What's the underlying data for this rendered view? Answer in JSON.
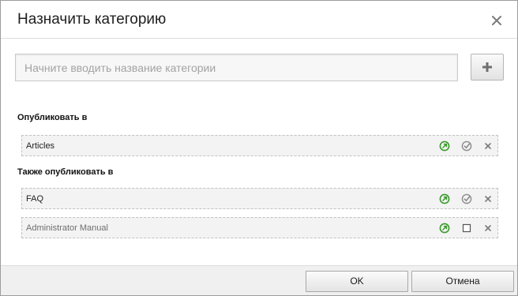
{
  "dialog": {
    "title": "Назначить категорию",
    "close_icon": "close-icon"
  },
  "search": {
    "placeholder": "Начните вводить название категории",
    "value": ""
  },
  "add_button": {
    "icon": "plus-icon"
  },
  "primary": {
    "label": "Опубликовать в",
    "items": [
      {
        "name": "Articles",
        "checked_state": "check-circle-icon",
        "muted": false
      }
    ]
  },
  "additional": {
    "label": "Также опубликовать в",
    "items": [
      {
        "name": "FAQ",
        "checked_state": "check-circle-icon",
        "muted": false
      },
      {
        "name": "Administrator Manual",
        "checked_state": "empty-checkbox-icon",
        "muted": true
      }
    ]
  },
  "footer": {
    "ok_label": "OK",
    "cancel_label": "Отмена"
  },
  "colors": {
    "link_icon_green": "#3a9a2c",
    "icon_gray": "#8c8c8c"
  }
}
